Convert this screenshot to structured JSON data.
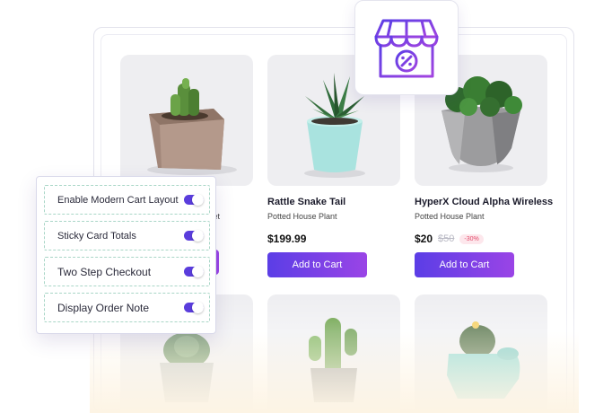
{
  "products": [
    {
      "title": "",
      "subtitle": "set",
      "price": "",
      "button": "Add to Cart"
    },
    {
      "title": "Rattle Snake Tail",
      "subtitle": "Potted House Plant",
      "price": "$199.99",
      "button": "Add to Cart"
    },
    {
      "title": "HyperX Cloud Alpha Wireless",
      "subtitle": "Potted House Plant",
      "price": "$20",
      "old_price": "$50",
      "discount": "-30%",
      "button": "Add to Cart"
    }
  ],
  "settings_panel": {
    "options": [
      {
        "label": "Enable Modern Cart Layout",
        "enabled": true
      },
      {
        "label": "Sticky Card Totals",
        "enabled": true
      },
      {
        "label": "Two Step Checkout",
        "enabled": true
      },
      {
        "label": "Display Order Note",
        "enabled": true
      }
    ]
  },
  "icons": {
    "store": "store-discount-icon"
  },
  "colors": {
    "accent_start": "#5b3ee6",
    "accent_end": "#9a44e6",
    "toggle": "#5a3ddc",
    "badge_text": "#e24b6a"
  }
}
